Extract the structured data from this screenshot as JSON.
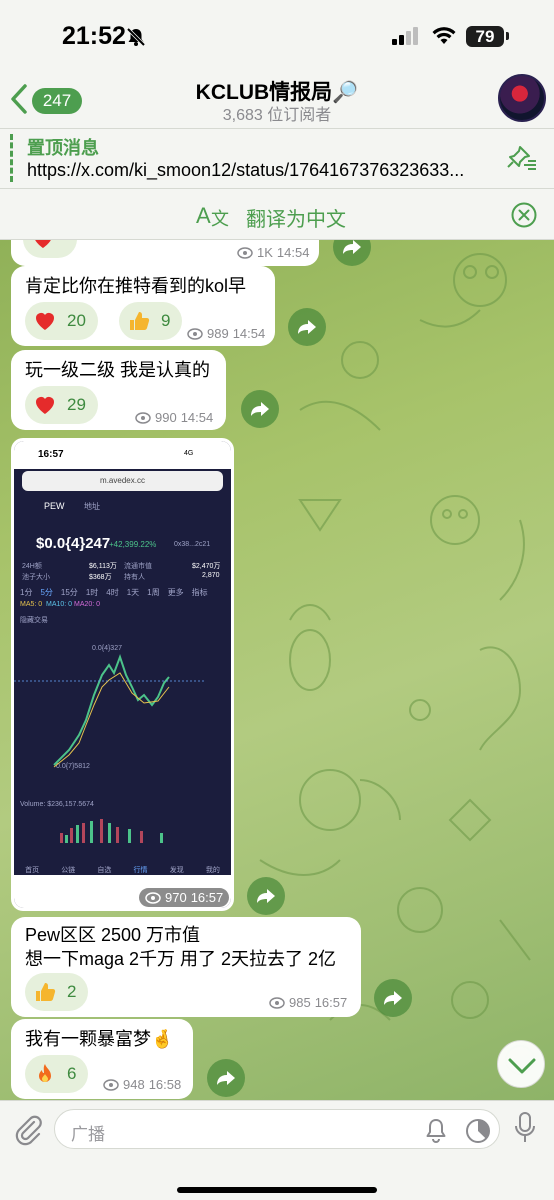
{
  "status_bar": {
    "time": "21:52",
    "battery": "79"
  },
  "header": {
    "unread_count": "247",
    "title": "KCLUB情报局🔎",
    "subscribers": "3,683 位订阅者"
  },
  "pinned": {
    "title": "置顶消息",
    "text": "https://x.com/ki_smoon12/status/1764167376323633..."
  },
  "translate": {
    "label": "翻译为中文"
  },
  "messages": [
    {
      "reactions": [
        {
          "emoji": "heart",
          "count": ""
        }
      ],
      "views": "1K",
      "time": "14:54"
    },
    {
      "text": "肯定比你在推特看到的kol早",
      "reactions": [
        {
          "emoji": "heart",
          "count": "20"
        },
        {
          "emoji": "thumbs-up",
          "count": "9"
        }
      ],
      "views": "989",
      "time": "14:54"
    },
    {
      "text": "玩一级二级 我是认真的",
      "reactions": [
        {
          "emoji": "heart",
          "count": "29"
        }
      ],
      "views": "990",
      "time": "14:54"
    },
    {
      "image": {
        "time": "16:57",
        "net": "4G",
        "url": "m.avedex.cc",
        "token": "PEW",
        "search_placeholder": "地址",
        "price": "$0.0{4}247",
        "change": "+42,399.22%",
        "contract": "0x38...2c21",
        "vol_label": "24H额",
        "vol": "$6,113万",
        "mcap_label": "流通市值",
        "mcap": "$2,470万",
        "pool_label": "池子大小",
        "pool": "$368万",
        "holders_label": "持有人",
        "holders": "2,870",
        "tabs": [
          "1分",
          "5分",
          "15分",
          "1时",
          "4时",
          "1天",
          "1周",
          "更多",
          "指标"
        ],
        "ma": [
          "MA5: 0",
          "MA10: 0",
          "MA20: 0"
        ],
        "hide_label": "隐藏交易",
        "high_label": "0.0{4}327",
        "low_label": "0.0{7}5812",
        "volume": "Volume: $236,157.5674",
        "nav": [
          "首页",
          "公链",
          "自选",
          "行情",
          "发现",
          "我的"
        ]
      },
      "views": "970",
      "time": "16:57"
    },
    {
      "text": "Pew区区 2500 万市值\n想一下maga 2千万 用了 2天拉去了 2亿",
      "reactions": [
        {
          "emoji": "thumbs-up",
          "count": "2"
        }
      ],
      "views": "985",
      "time": "16:57"
    },
    {
      "text": "我有一颗暴富梦🤞",
      "reactions": [
        {
          "emoji": "fire",
          "count": "6"
        }
      ],
      "views": "948",
      "time": "16:58"
    }
  ],
  "input": {
    "placeholder": "广播"
  },
  "colors": {
    "accent": "#4d9e4f",
    "chat_bg": "#a7c36a",
    "bubble": "#ffffff"
  }
}
